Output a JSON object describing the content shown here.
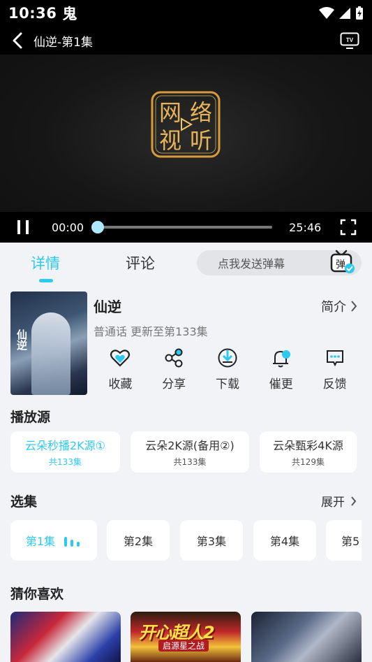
{
  "status_bar": {
    "time": "10:36",
    "app_glyph": "鬼"
  },
  "player": {
    "title": "仙逆-第1集",
    "current_time": "00:00",
    "total_time": "25:46",
    "progress_fraction": 0.0,
    "seal_glyphs": [
      "网",
      "络",
      "视",
      "听"
    ]
  },
  "tabs": {
    "details": "详情",
    "comments": "评论"
  },
  "danmaku": {
    "placeholder": "点我发送弹幕",
    "icon_glyph": "弹"
  },
  "show": {
    "title": "仙逆",
    "meta": "普通话 更新至第133集",
    "intro_label": "简介",
    "poster_text": "仙逆"
  },
  "actions": [
    {
      "label": "收藏",
      "icon": "heart-icon"
    },
    {
      "label": "分享",
      "icon": "share-icon"
    },
    {
      "label": "下载",
      "icon": "download-icon"
    },
    {
      "label": "催更",
      "icon": "bell-icon"
    },
    {
      "label": "反馈",
      "icon": "feedback-icon"
    }
  ],
  "sources": {
    "title": "播放源",
    "items": [
      {
        "name": "云朵秒播2K源①",
        "count": "共133集",
        "active": true
      },
      {
        "name": "云朵2K源(备用②)",
        "count": "共133集",
        "active": false
      },
      {
        "name": "云朵甄彩4K源",
        "count": "共129集",
        "active": false
      }
    ]
  },
  "episodes": {
    "title": "选集",
    "expand_label": "展开",
    "items": [
      "第1集",
      "第2集",
      "第3集",
      "第4集",
      "第5"
    ]
  },
  "recommendations": {
    "title": "猜你喜欢",
    "items": [
      {
        "caption": ""
      },
      {
        "caption": "开心超人2",
        "sub": "启源星之战"
      },
      {
        "caption": ""
      }
    ]
  },
  "colors": {
    "accent": "#2ec9ef",
    "background": "#f1f3f6",
    "player_bg": "#000000"
  }
}
